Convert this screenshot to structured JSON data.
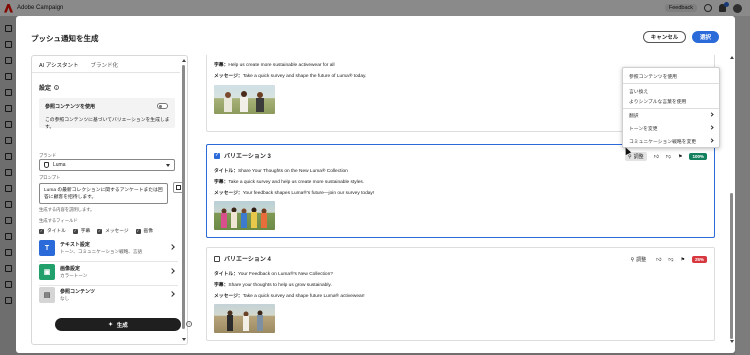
{
  "app": {
    "title": "Adobe Campaign",
    "feedback_label": "Feedback"
  },
  "modal": {
    "title": "プッシュ通知を生成",
    "cancel_label": "キャンセル",
    "select_label": "選択"
  },
  "left_panel": {
    "tabs": [
      {
        "label": "AI アシスタント",
        "active": true
      },
      {
        "label": "ブランド化",
        "active": false
      }
    ],
    "settings_label": "設定",
    "reference": {
      "title": "参照コンテンツを使用",
      "desc": "この参照コンテンツに基づいてバリエーションを生成します。",
      "enabled": false
    },
    "brand_label": "ブランド",
    "brand_value": "Luma",
    "prompt_label": "プロンプト",
    "prompt_text": "Luma の最新コレクションに関するアンケートまたは回答に顧客を招待します。",
    "prompt_hint": "生成する内容を説明します。",
    "fields_label": "生成するフィールド",
    "fields": [
      {
        "label": "タイトル",
        "checked": true
      },
      {
        "label": "字幕",
        "checked": true
      },
      {
        "label": "メッセージ",
        "checked": true
      },
      {
        "label": "画像",
        "checked": true
      }
    ],
    "options": [
      {
        "title": "テキスト設定",
        "subtitle": "トーン、コミュニケーション戦略、言語",
        "icon": "text-icon",
        "color": "#2a6ad9"
      },
      {
        "title": "画像設定",
        "subtitle": "カラートーン",
        "icon": "image-icon",
        "color": "#22a06b"
      },
      {
        "title": "参照コンテンツ",
        "subtitle": "なし",
        "icon": "reference-icon",
        "color": "#6d6d6d"
      }
    ],
    "generate_label": "生成"
  },
  "variations": [
    {
      "name": "",
      "checked": false,
      "title": "",
      "subtitle": "Help us create more sustainable activewear for all",
      "message": "Take a quick survey and shape the future of Luma® today.",
      "score": "",
      "adjust_label": ""
    },
    {
      "name": "バリエーション 3",
      "checked": true,
      "title": "Share Your Thoughts on the New Luma® Collection",
      "subtitle": "Take a quick survey and help us create more sustainable styles.",
      "message": "Your feedback shapes Luma®'s future—join our survey today!",
      "score": "100%",
      "score_color": "#12805c",
      "adjust_label": "調整"
    },
    {
      "name": "バリエーション 4",
      "checked": false,
      "title": "Your Feedback on Luma®'s New Collection?",
      "subtitle": "Share your thoughts to help us grow sustainably.",
      "message": "Take a quick survey and shape future Luma® activewear!",
      "score": "25%",
      "score_color": "#d7373f",
      "adjust_label": "調整"
    }
  ],
  "field_labels": {
    "title": "タイトル：",
    "subtitle": "字幕：",
    "message": "メッセージ："
  },
  "menu": {
    "items": [
      "参照コンテンツを使用",
      "言い換え",
      "よりシンプルな言葉を使用",
      "翻訳",
      "トーンを変更",
      "コミュニケーション戦略を変更"
    ],
    "submenu": [
      false,
      false,
      false,
      true,
      true,
      true
    ]
  }
}
